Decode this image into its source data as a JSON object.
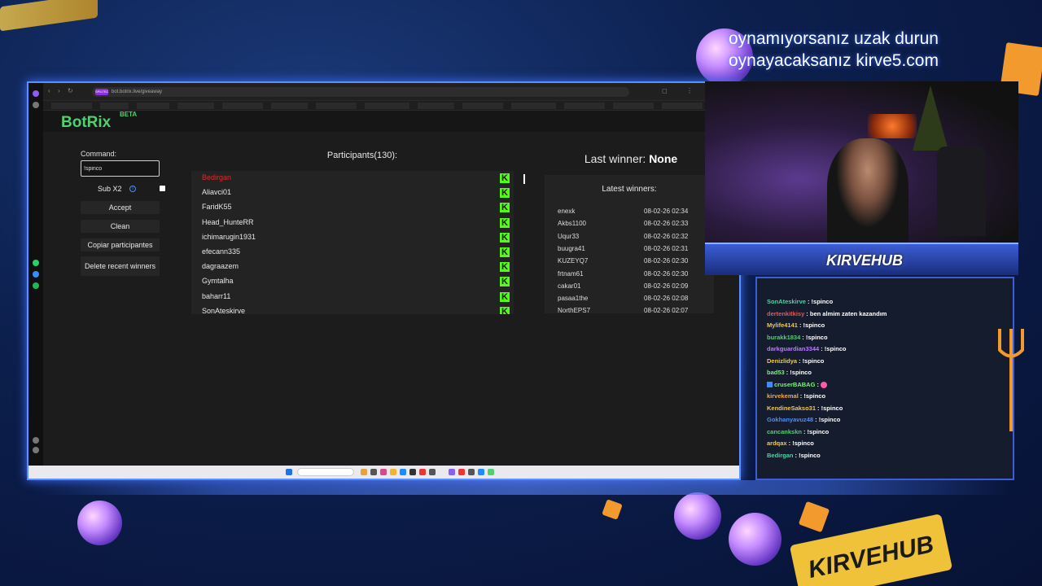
{
  "overlay": {
    "promo_line1": "oynamıyorsanız uzak durun",
    "promo_line2": "oynayacaksanız kirve5.com",
    "brand": "KIRVEHUB"
  },
  "browser": {
    "url": "bot.botrix.live/giveaway",
    "url_badge": "SPILTEC"
  },
  "app": {
    "logo": "BotRix",
    "logo_badge": "BETA"
  },
  "controls": {
    "command_label": "Command:",
    "command_value": "!spinco",
    "sub_label": "Sub X2",
    "sub_checked": true,
    "accept": "Accept",
    "clean": "Clean",
    "copy": "Copiar participantes",
    "delete": "Delete recent winners"
  },
  "participants": {
    "title": "Participants(130):",
    "items": [
      {
        "name": "Bedirgan",
        "highlight": true
      },
      {
        "name": "Aliavci01"
      },
      {
        "name": "FaridK55"
      },
      {
        "name": "Head_HunteRR"
      },
      {
        "name": "ichimarugin1931"
      },
      {
        "name": "efecann335"
      },
      {
        "name": "dagraazem"
      },
      {
        "name": "Gymtalha"
      },
      {
        "name": "baharr11"
      },
      {
        "name": "SonAteskirve"
      }
    ],
    "platform_icon": "kick-icon",
    "platform_glyph": "K"
  },
  "winners": {
    "last_label": "Last winner:",
    "last_value": "None",
    "latest_title": "Latest winners:",
    "items": [
      {
        "name": "enexk",
        "time": "08-02-26 02:34"
      },
      {
        "name": "Akbs1100",
        "time": "08-02-26 02:33"
      },
      {
        "name": "Uqur33",
        "time": "08-02-26 02:32"
      },
      {
        "name": "buugra41",
        "time": "08-02-26 02:31"
      },
      {
        "name": "KUZEYQ7",
        "time": "08-02-26 02:30"
      },
      {
        "name": "frtnam61",
        "time": "08-02-26 02:30"
      },
      {
        "name": "cakar01",
        "time": "08-02-26 02:09"
      },
      {
        "name": "pasaa1the",
        "time": "08-02-26 02:08"
      },
      {
        "name": "NorthEPS7",
        "time": "08-02-26 02:07"
      }
    ]
  },
  "chat": {
    "messages": [
      {
        "user": "SonAteskirve",
        "color": "#4fd1a0",
        "text": ": !spinco"
      },
      {
        "user": "dertenkitkisy",
        "color": "#e05a5a",
        "text": ": ben almim zaten kazandım"
      },
      {
        "user": "Mylife4141",
        "color": "#f2c94c",
        "text": ": !spinco"
      },
      {
        "user": "burakk1834",
        "color": "#4fd16f",
        "text": ": !spinco"
      },
      {
        "user": "darkguardian3344",
        "color": "#b77cff",
        "text": ": !spinco"
      },
      {
        "user": "Denizlidya",
        "color": "#f2c94c",
        "text": ": !spinco"
      },
      {
        "user": "bad53",
        "color": "#7cf07c",
        "text": ": !spinco"
      },
      {
        "user": "cruserBABAG",
        "color": "#7cf07c",
        "text": ":",
        "badge": true,
        "emote": true
      },
      {
        "user": "kirvekemal",
        "color": "#f2a94c",
        "text": ": !spinco"
      },
      {
        "user": "KendineSakso31",
        "color": "#f2c94c",
        "text": ": !spinco"
      },
      {
        "user": "Gokhanyavuz48",
        "color": "#4d8dff",
        "text": ": !spinco"
      },
      {
        "user": "cancankskn",
        "color": "#4fd16f",
        "text": ": !spinco"
      },
      {
        "user": "ardqax",
        "color": "#f2c94c",
        "text": ": !spinco"
      },
      {
        "user": "Bedirgan",
        "color": "#4fd1a0",
        "text": ": !spinco"
      }
    ]
  },
  "colors": {
    "accent": "#4fd16f",
    "kick_green": "#53fc18",
    "winner_highlight": "#e02a2a"
  }
}
